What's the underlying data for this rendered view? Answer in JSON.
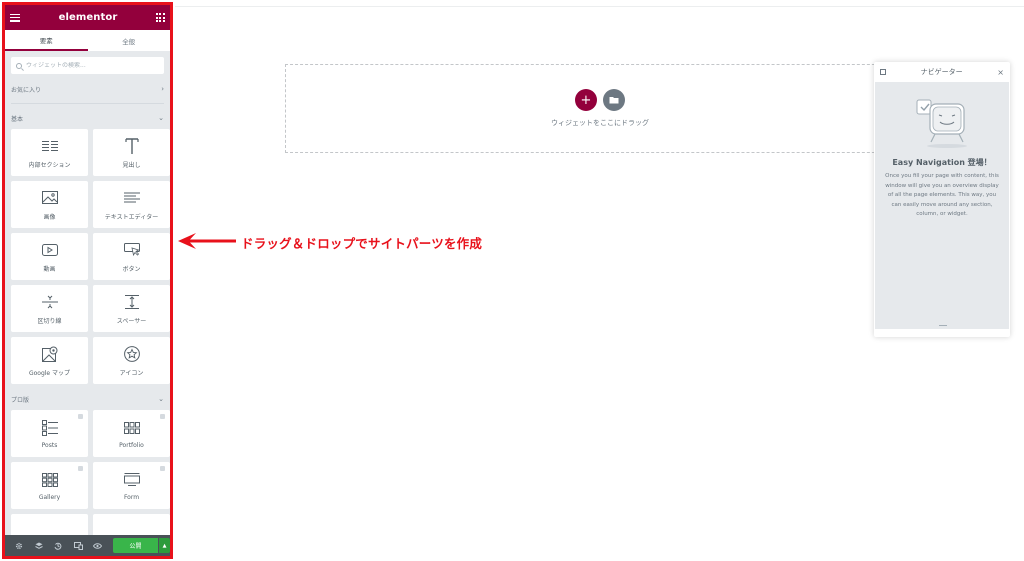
{
  "panel": {
    "logo": "elementor",
    "tabs": [
      {
        "label": "要素",
        "active": true
      },
      {
        "label": "全般",
        "active": false
      }
    ],
    "search_placeholder": "ウィジェットの検索...",
    "sections": {
      "favorites": "お気に入り",
      "basic": "基本",
      "pro": "プロ版"
    },
    "basic_widgets": [
      {
        "label": "内部セクション",
        "icon": "inner-section-icon"
      },
      {
        "label": "見出し",
        "icon": "heading-icon"
      },
      {
        "label": "画像",
        "icon": "image-icon"
      },
      {
        "label": "テキストエディター",
        "icon": "text-editor-icon"
      },
      {
        "label": "動画",
        "icon": "video-icon"
      },
      {
        "label": "ボタン",
        "icon": "button-icon"
      },
      {
        "label": "区切り線",
        "icon": "divider-icon"
      },
      {
        "label": "スペーサー",
        "icon": "spacer-icon"
      },
      {
        "label": "Google マップ",
        "icon": "google-maps-icon"
      },
      {
        "label": "アイコン",
        "icon": "star-icon"
      }
    ],
    "pro_widgets": [
      {
        "label": "Posts",
        "icon": "posts-icon"
      },
      {
        "label": "Portfolio",
        "icon": "portfolio-icon"
      },
      {
        "label": "Gallery",
        "icon": "gallery-icon"
      },
      {
        "label": "Form",
        "icon": "form-icon"
      }
    ],
    "footer": {
      "publish": "公開",
      "icons": [
        "settings-icon",
        "navigator-icon",
        "history-icon",
        "responsive-icon",
        "preview-icon"
      ]
    }
  },
  "canvas": {
    "drop_label": "ウィジェットをここにドラッグ"
  },
  "annotation": {
    "text": "ドラッグ＆ドロップでサイトパーツを作成",
    "color": "#e8111b"
  },
  "navigator": {
    "title": "ナビゲーター",
    "empty_title": "Easy Navigation 登場！",
    "empty_text": "Once you fill your page with content, this window will give you an overview display of all the page elements. This way, you can easily move around any section, column, or widget."
  },
  "colors": {
    "brand": "#93003c",
    "publish": "#39b54a",
    "panel_bg": "#e6e9ec",
    "footer_bg": "#495157"
  }
}
